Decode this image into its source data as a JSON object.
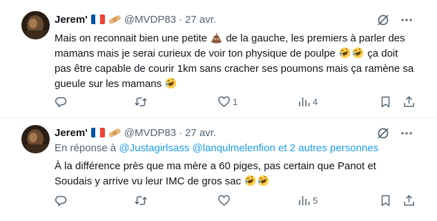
{
  "colors": {
    "text": "#0f1419",
    "secondary": "#536471",
    "link": "#1d9bf0",
    "divider": "#eff3f4"
  },
  "tweets": [
    {
      "author_name": "Jerem'",
      "handle": "@MVDP83",
      "separator": "·",
      "date": "27 avr.",
      "text_parts": [
        "Mais on reconnait bien une petite ",
        " de la gauche, les premiers à parler des mamans mais je serai curieux de voir ton physique de poulpe ",
        " ça doit pas être capable de courir 1km sans cracher ses poumons mais ça ramène sa gueule sur les mamans "
      ],
      "emojis": [
        "poop-emoji",
        "rofl-emoji",
        "rofl-emoji",
        "rofl-emoji"
      ],
      "counts": {
        "replies": "",
        "retweets": "",
        "likes": "1",
        "views": "4"
      }
    },
    {
      "author_name": "Jerem'",
      "handle": "@MVDP83",
      "separator": "·",
      "date": "27 avr.",
      "reply_to_prefix": "En réponse à",
      "reply_to_mentions": [
        "@Justagirlsass",
        "@lanqulmelenfion"
      ],
      "reply_to_others": "et 2 autres personnes",
      "text_parts": [
        "À la différence près que ma mère a 60 piges, pas certain que Panot et Soudais y arrive vu leur IMC de gros sac "
      ],
      "emojis": [
        "rofl-emoji",
        "rofl-emoji"
      ],
      "counts": {
        "replies": "",
        "retweets": "",
        "likes": "",
        "views": "5"
      }
    }
  ],
  "icons": [
    "avatar",
    "french-flag-icon",
    "bandage-icon",
    "grok-icon",
    "more-icon",
    "reply-icon",
    "retweet-icon",
    "like-icon",
    "views-icon",
    "bookmark-icon",
    "share-icon"
  ]
}
